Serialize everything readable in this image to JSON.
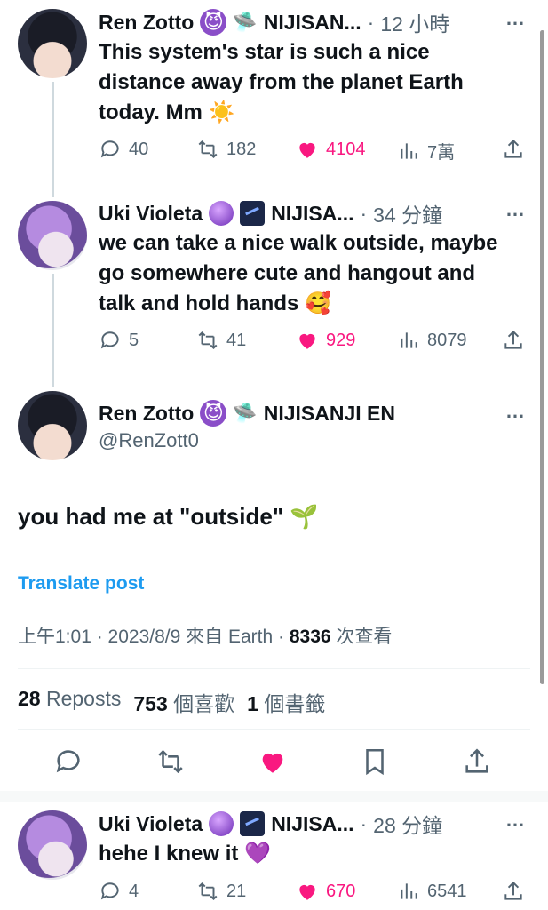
{
  "posts": [
    {
      "name": "Ren Zotto",
      "org": "NIJISAN...",
      "time": "12 小時",
      "text": "This system's star is such a nice distance away from the planet Earth today. Mm ☀️",
      "replies": "40",
      "reposts": "182",
      "likes": "4104",
      "views": "7萬"
    },
    {
      "name": "Uki Violeta",
      "org": "NIJISA...",
      "time": "34 分鐘",
      "text": "we can take a nice walk outside, maybe go somewhere cute and hangout and talk and hold hands 🥰",
      "replies": "5",
      "reposts": "41",
      "likes": "929",
      "views": "8079"
    }
  ],
  "main": {
    "name": "Ren Zotto",
    "org": "NIJISANJI EN",
    "handle": "@RenZott0",
    "text": "you had me at \"outside\" 🌱",
    "translate": "Translate post",
    "time": "上午1:01",
    "date": "2023/8/9",
    "source": "來自 Earth",
    "views_count": "8336",
    "views_label": "次查看",
    "reposts_count": "28",
    "reposts_label": "Reposts",
    "likes_count": "753",
    "likes_label": "個喜歡",
    "bookmarks_count": "1",
    "bookmarks_label": "個書籤"
  },
  "reply": {
    "name": "Uki Violeta",
    "org": "NIJISA...",
    "time": "28 分鐘",
    "text": "hehe I knew it 💜",
    "replies": "4",
    "reposts": "21",
    "likes": "670",
    "views": "6541"
  },
  "icons": {
    "more": "…",
    "accent_like": "#f91880",
    "accent_link": "#1d9bf0"
  }
}
